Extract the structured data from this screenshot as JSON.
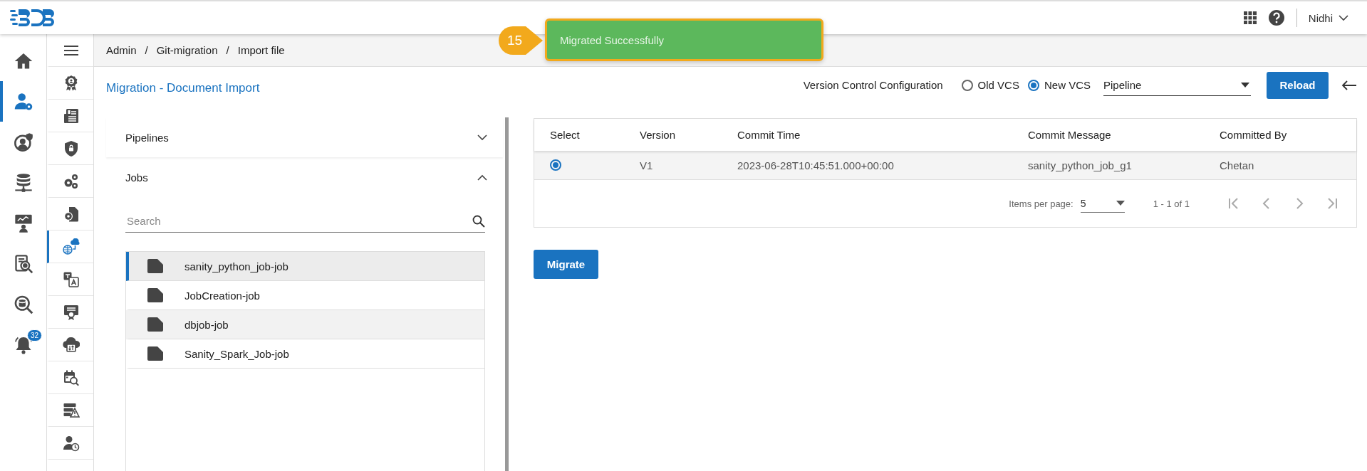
{
  "header": {
    "user": "Nidhi"
  },
  "toast": {
    "step": "15",
    "message": "Migrated Successfully"
  },
  "nav_rail": [
    {
      "selected": false
    },
    {
      "selected": true
    },
    {
      "selected": false
    },
    {
      "selected": false
    },
    {
      "selected": false
    },
    {
      "selected": false
    },
    {
      "selected": false
    },
    {
      "selected": false,
      "badge": "32"
    }
  ],
  "sub_rail": [
    {
      "selected": false
    },
    {
      "selected": false
    },
    {
      "selected": false
    },
    {
      "selected": false
    },
    {
      "selected": false
    },
    {
      "selected": true
    },
    {
      "selected": false
    },
    {
      "selected": false
    },
    {
      "selected": false
    },
    {
      "selected": false
    },
    {
      "selected": false
    },
    {
      "selected": false
    }
  ],
  "breadcrumb": [
    "Admin",
    "/",
    "Git-migration",
    "/",
    "Import file"
  ],
  "page_title": "Migration - Document Import",
  "accordion": [
    {
      "title": "Pipelines",
      "expanded": false
    },
    {
      "title": "Jobs",
      "expanded": true,
      "search": {
        "placeholder": "Search"
      },
      "items": [
        {
          "label": "sanity_python_job-job",
          "selected": true
        },
        {
          "label": "JobCreation-job",
          "selected": false
        },
        {
          "label": "dbjob-job",
          "selected": false
        },
        {
          "label": "Sanity_Spark_Job-job",
          "selected": false
        }
      ]
    }
  ],
  "vcs": {
    "label": "Version Control Configuration",
    "options": [
      {
        "label": "Old VCS",
        "selected": false
      },
      {
        "label": "New VCS",
        "selected": true
      }
    ],
    "select_value": "Pipeline",
    "reload": "Reload"
  },
  "table": {
    "columns": [
      "Select",
      "Version",
      "Commit Time",
      "Commit Message",
      "Committed By"
    ],
    "rows": [
      {
        "selected": true,
        "cells": [
          "",
          "V1",
          "2023-06-28T10:45:51.000+00:00",
          "sanity_python_job_g1",
          "Chetan"
        ]
      }
    ]
  },
  "paginator": {
    "label": "Items per page:",
    "page_size": "5",
    "range": "1 - 1 of 1"
  },
  "migrate": "Migrate"
}
